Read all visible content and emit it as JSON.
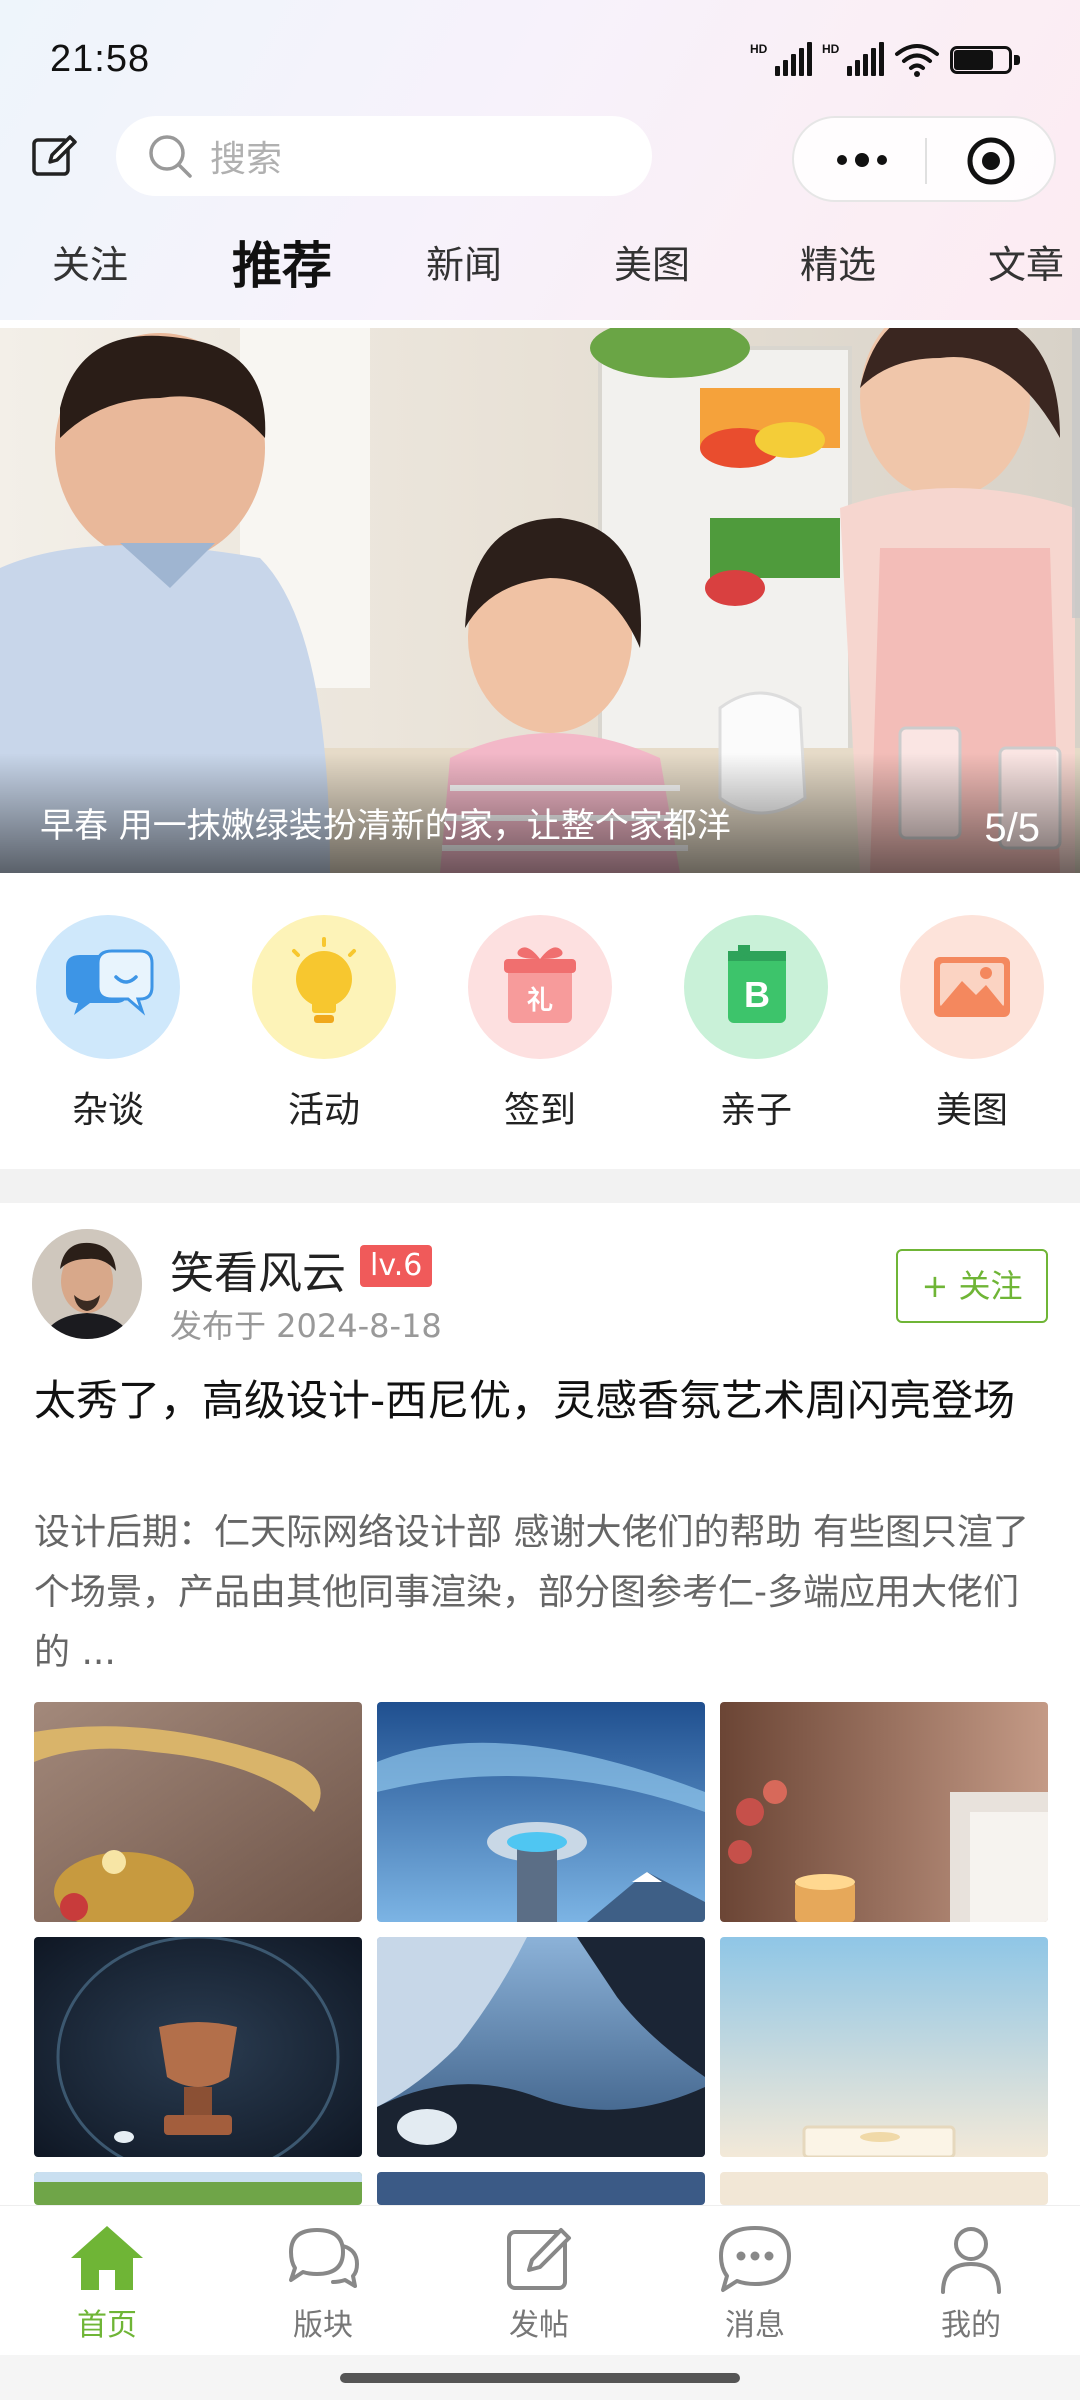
{
  "status_bar": {
    "time": "21:58",
    "signal_1_label": "HD",
    "signal_2_label": "HD",
    "battery_level": 0.72
  },
  "header": {
    "search_placeholder": "搜索"
  },
  "tabs": [
    {
      "label": "关注",
      "active": false
    },
    {
      "label": "推荐",
      "active": true
    },
    {
      "label": "新闻",
      "active": false
    },
    {
      "label": "美图",
      "active": false
    },
    {
      "label": "精选",
      "active": false
    },
    {
      "label": "文章",
      "active": false
    }
  ],
  "banner": {
    "caption": "早春 用一抹嫩绿装扮清新的家，让整个家都洋",
    "index": "5/5"
  },
  "categories": [
    {
      "label": "杂谈",
      "icon": "chat-bubbles-icon",
      "color": "#cfe8fb"
    },
    {
      "label": "活动",
      "icon": "lightbulb-icon",
      "color": "#fdf3b8"
    },
    {
      "label": "签到",
      "icon": "gift-icon",
      "color": "#fde0e0"
    },
    {
      "label": "亲子",
      "icon": "book-icon",
      "color": "#c9f1d8"
    },
    {
      "label": "美图",
      "icon": "picture-icon",
      "color": "#fde3da"
    }
  ],
  "post": {
    "author": "笑看风云",
    "level": "lv.6",
    "date": "发布于 2024-8-18",
    "follow_label": "+ 关注",
    "title": "太秀了，高级设计-西尼优，灵感香氛艺术周闪亮登场",
    "excerpt": "设计后期：仁天际网络设计部 感谢大佬们的帮助 有些图只渲了个场景，产品由其他同事渲染，部分图参考仁-多端应用大佬们的 ..."
  },
  "bottom_nav": [
    {
      "label": "首页",
      "icon": "home-icon",
      "active": true
    },
    {
      "label": "版块",
      "icon": "forum-bubbles-icon",
      "active": false
    },
    {
      "label": "发帖",
      "icon": "compose-icon",
      "active": false
    },
    {
      "label": "消息",
      "icon": "message-icon",
      "active": false
    },
    {
      "label": "我的",
      "icon": "user-icon",
      "active": false
    }
  ],
  "colors": {
    "accent_green": "#6fb536",
    "level_badge": "#f05a5a"
  }
}
